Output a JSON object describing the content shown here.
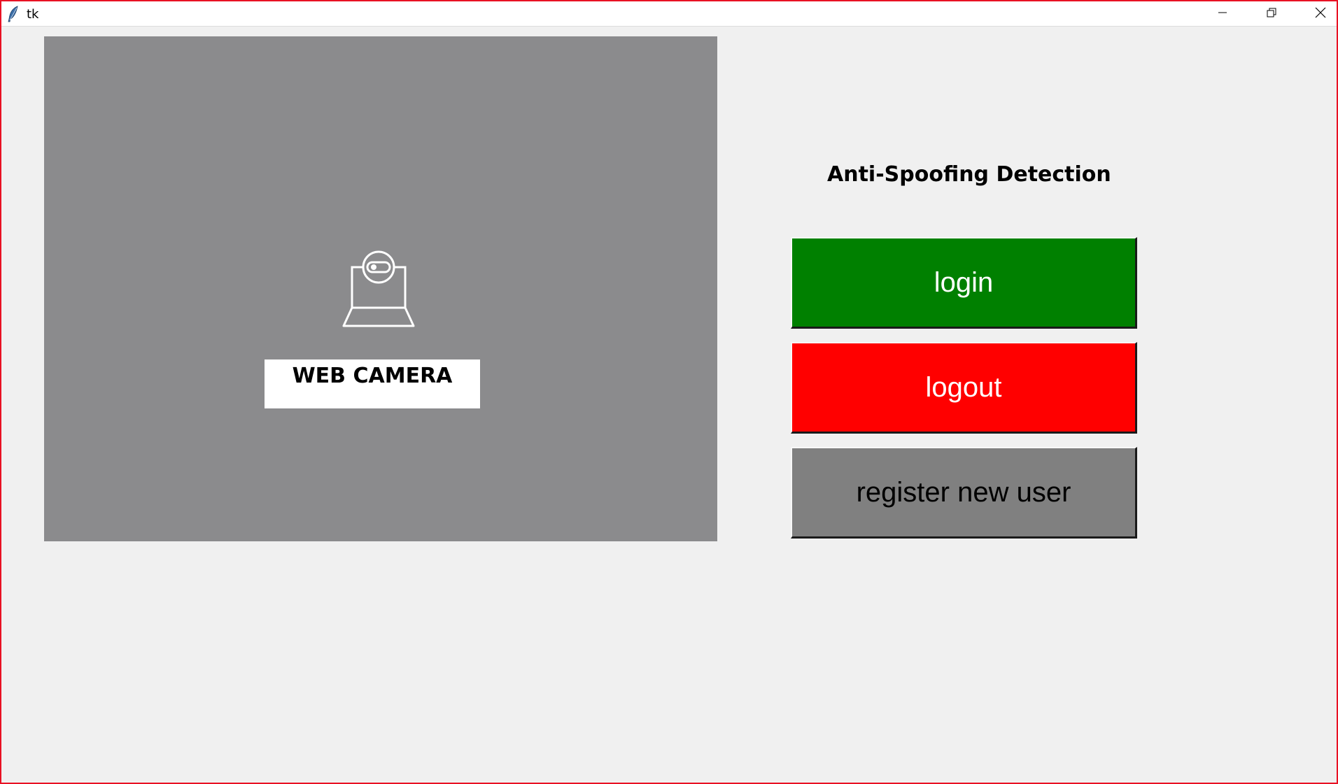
{
  "window": {
    "title": "tk",
    "icons": {
      "app": "feather-icon",
      "minimize": "minimize-icon",
      "maximize": "restore-icon",
      "close": "close-icon"
    }
  },
  "camera": {
    "icon": "webcam-icon",
    "label": "WEB CAMERA"
  },
  "app_title": "Anti-Spoofing Detection",
  "buttons": {
    "login": "login",
    "logout": "logout",
    "register": "register new user"
  },
  "colors": {
    "login_bg": "#008000",
    "logout_bg": "#ff0000",
    "register_bg": "#808080",
    "camera_bg": "#8b8b8d",
    "window_border": "#e81123"
  }
}
